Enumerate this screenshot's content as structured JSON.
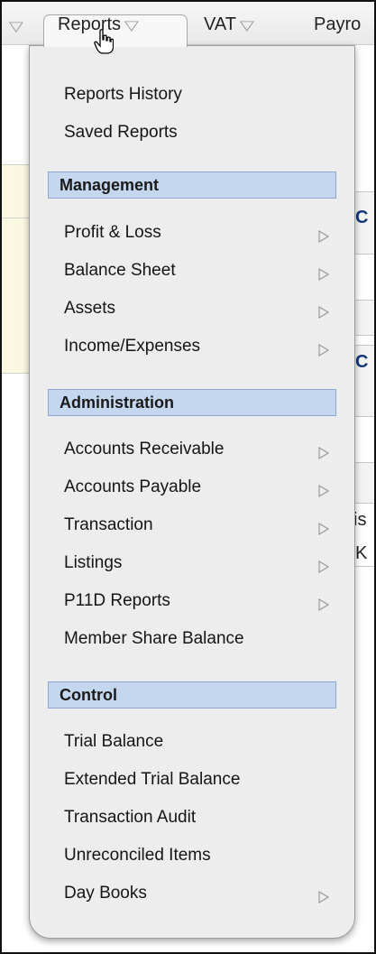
{
  "nav": {
    "reports_label": "Reports",
    "vat_label": "VAT",
    "payroll_label": "Payro"
  },
  "background": {
    "frag_1": "C",
    "frag_2": "C",
    "frag_3": "is",
    "frag_4": "K"
  },
  "menu": {
    "top_items": [
      "Reports History",
      "Saved Reports"
    ],
    "management": {
      "header": "Management",
      "items": [
        "Profit & Loss",
        "Balance Sheet",
        "Assets",
        "Income/Expenses"
      ]
    },
    "administration": {
      "header": "Administration",
      "items": [
        "Accounts Receivable",
        "Accounts Payable",
        "Transaction",
        "Listings",
        "P11D Reports",
        "Member Share Balance"
      ]
    },
    "control": {
      "header": "Control",
      "items": [
        "Trial Balance",
        "Extended Trial Balance",
        "Transaction Audit",
        "Unreconciled Items",
        "Day Books"
      ]
    }
  }
}
